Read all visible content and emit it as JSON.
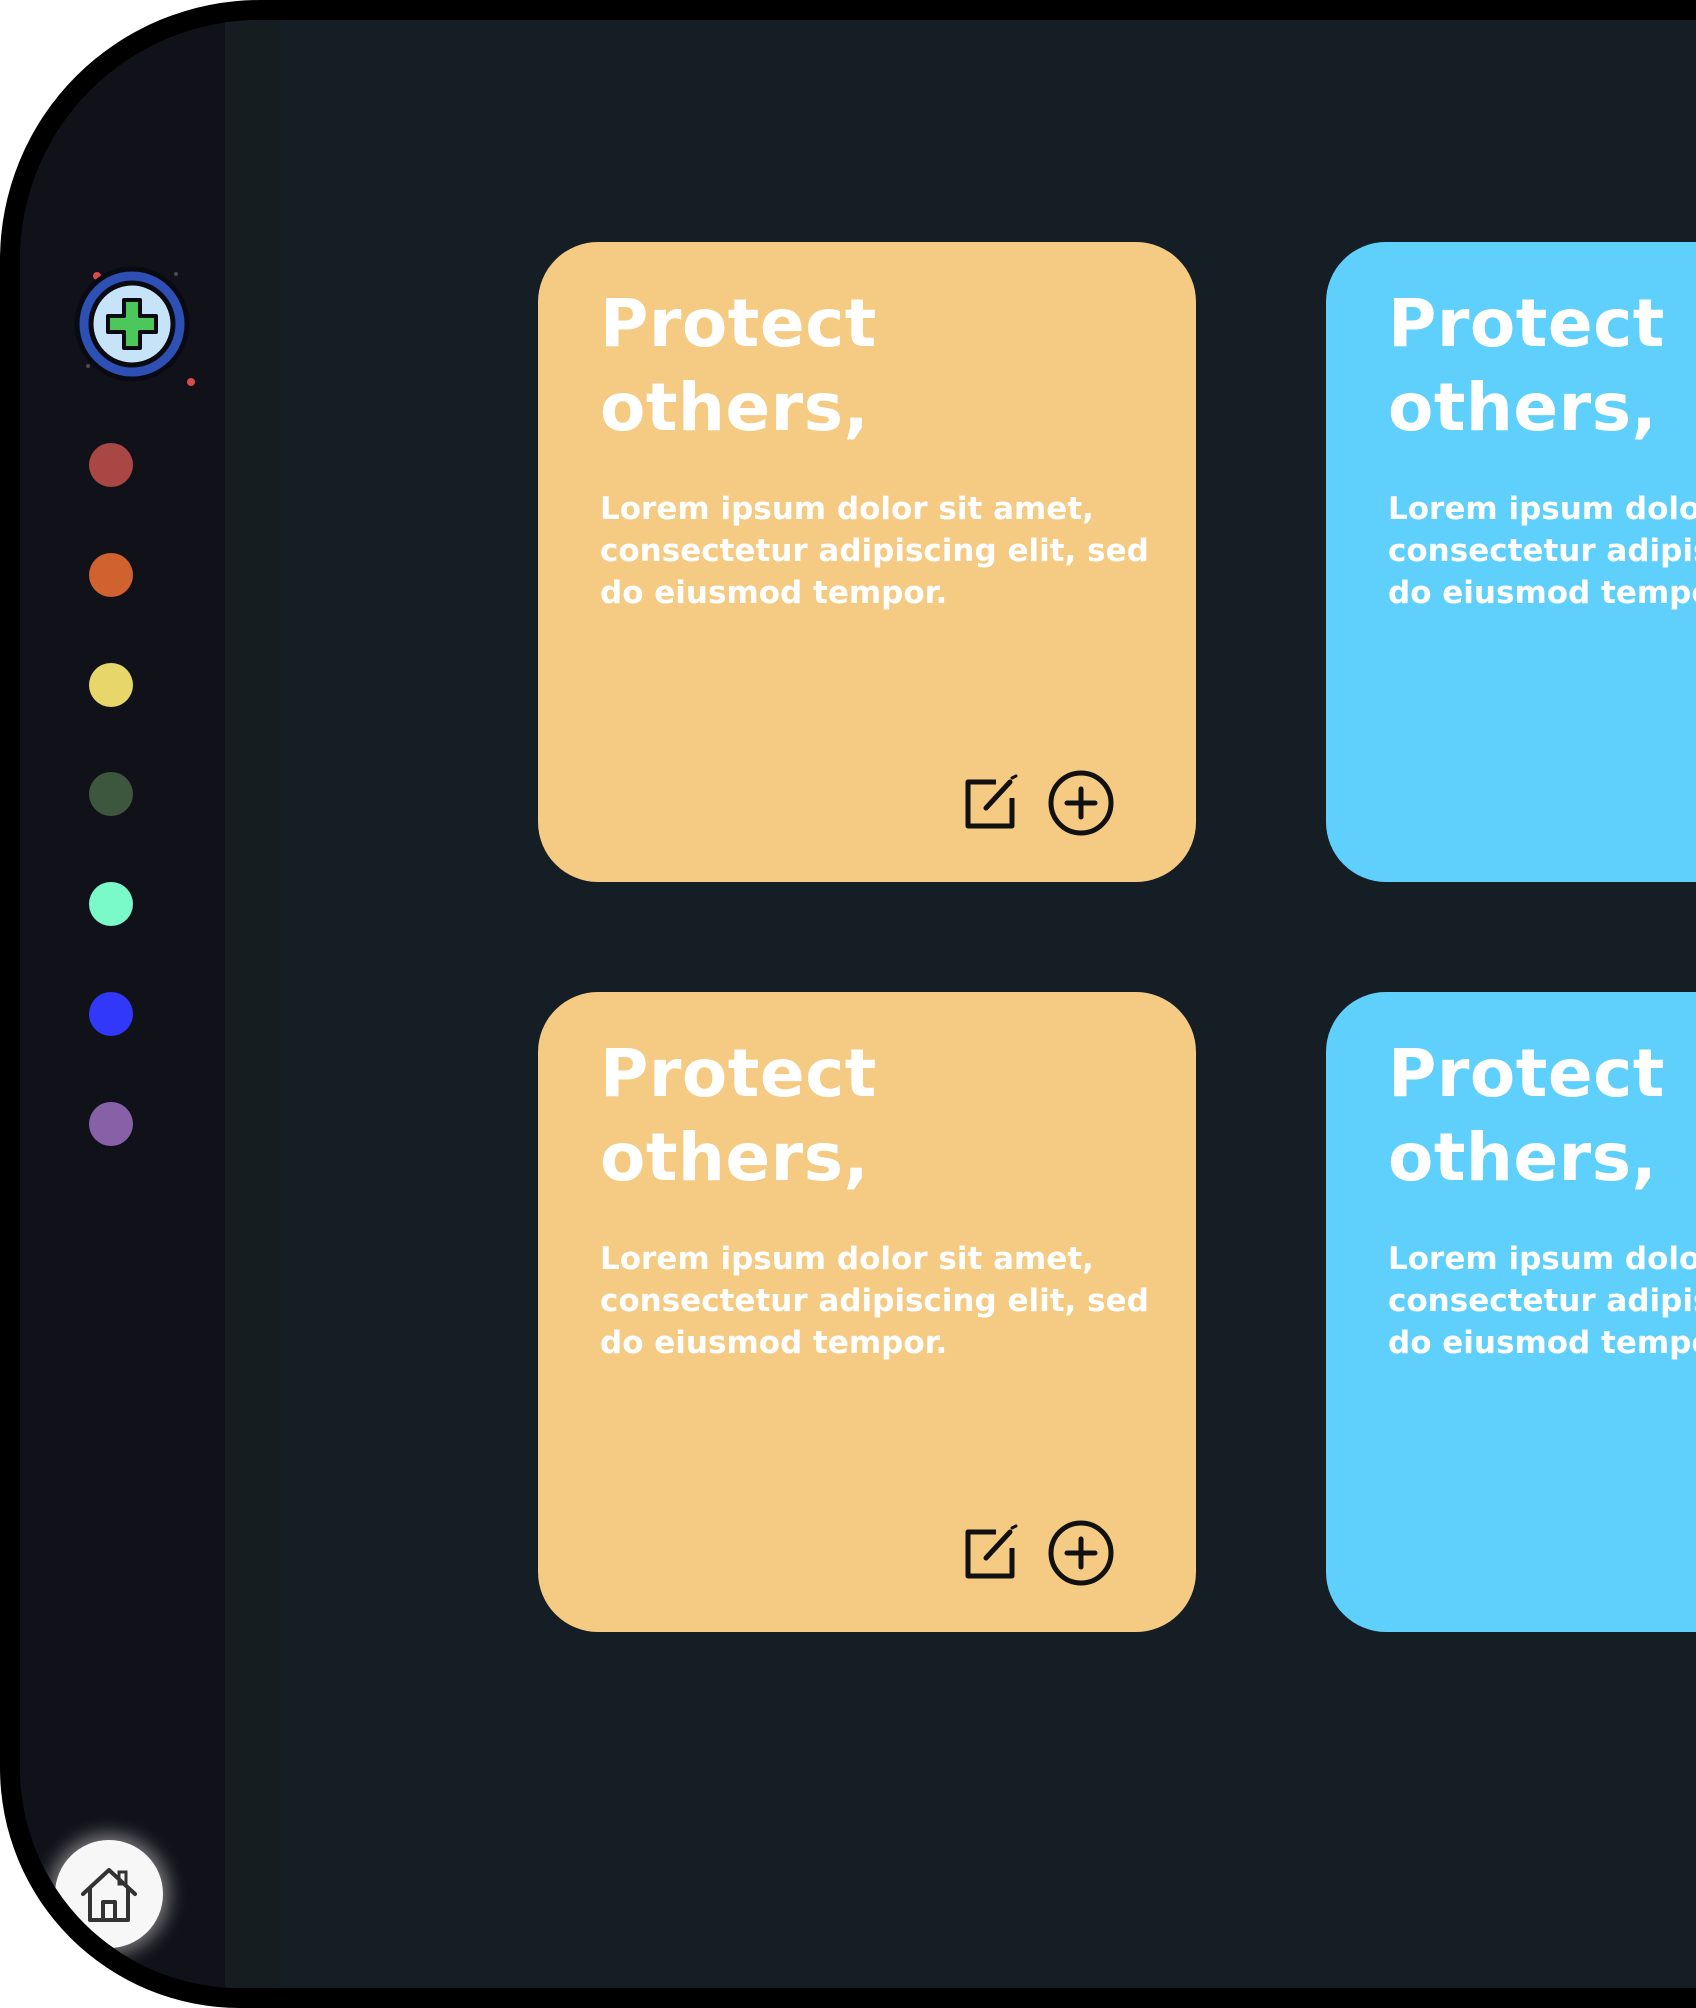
{
  "theme": {
    "background": "#151e24",
    "sidebar": "#111119",
    "card_orange": "#f5ca82",
    "card_blue": "#5fd0fb"
  },
  "sidebar": {
    "add_button_icon": "add-circle-icon",
    "color_palette": [
      {
        "name": "red",
        "color": "#a94745"
      },
      {
        "name": "orange",
        "color": "#cf622e"
      },
      {
        "name": "yellow",
        "color": "#e7d66a"
      },
      {
        "name": "dark-green",
        "color": "#3c573d"
      },
      {
        "name": "mint",
        "color": "#7afac8"
      },
      {
        "name": "blue",
        "color": "#3238f9"
      },
      {
        "name": "purple",
        "color": "#8661a8"
      }
    ],
    "home_icon": "home-icon"
  },
  "notes": [
    {
      "title": "Protect others,",
      "body": "Lorem ipsum dolor sit amet, consectetur adipiscing elit, sed do eiusmod tempor.",
      "color": "#f5ca82",
      "actions": [
        "edit-icon",
        "add-circle-icon"
      ]
    },
    {
      "title": "Protect others,",
      "body": "Lorem ipsum dolor sit amet, consectetur adipiscing elit, sed do eiusmod tempor.",
      "color": "#5fd0fb",
      "actions": []
    },
    {
      "title": "Protect others,",
      "body": "Lorem ipsum dolor sit amet, consectetur adipiscing elit, sed do eiusmod tempor.",
      "color": "#f5ca82",
      "actions": [
        "edit-icon",
        "add-circle-icon"
      ]
    },
    {
      "title": "Protect others,",
      "body": "Lorem ipsum dolor sit amet, consectetur adipiscing elit, sed do eiusmod tempor.",
      "color": "#5fd0fb",
      "actions": []
    }
  ]
}
